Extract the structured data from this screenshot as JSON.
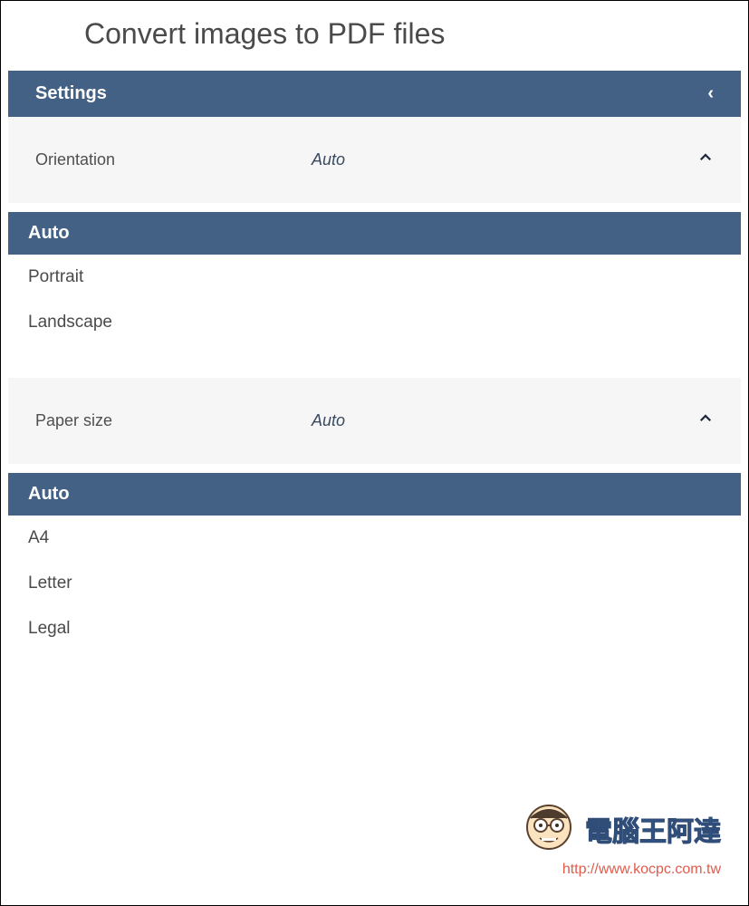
{
  "page": {
    "title": "Convert images to PDF files"
  },
  "settings": {
    "header": "Settings",
    "orientation": {
      "label": "Orientation",
      "value": "Auto",
      "options": {
        "selected": "Auto",
        "opt1": "Portrait",
        "opt2": "Landscape"
      }
    },
    "paper_size": {
      "label": "Paper size",
      "value": "Auto",
      "options": {
        "selected": "Auto",
        "opt1": "A4",
        "opt2": "Letter",
        "opt3": "Legal"
      }
    }
  },
  "watermark": {
    "title": "電腦王阿達",
    "url": "http://www.kocpc.com.tw"
  }
}
